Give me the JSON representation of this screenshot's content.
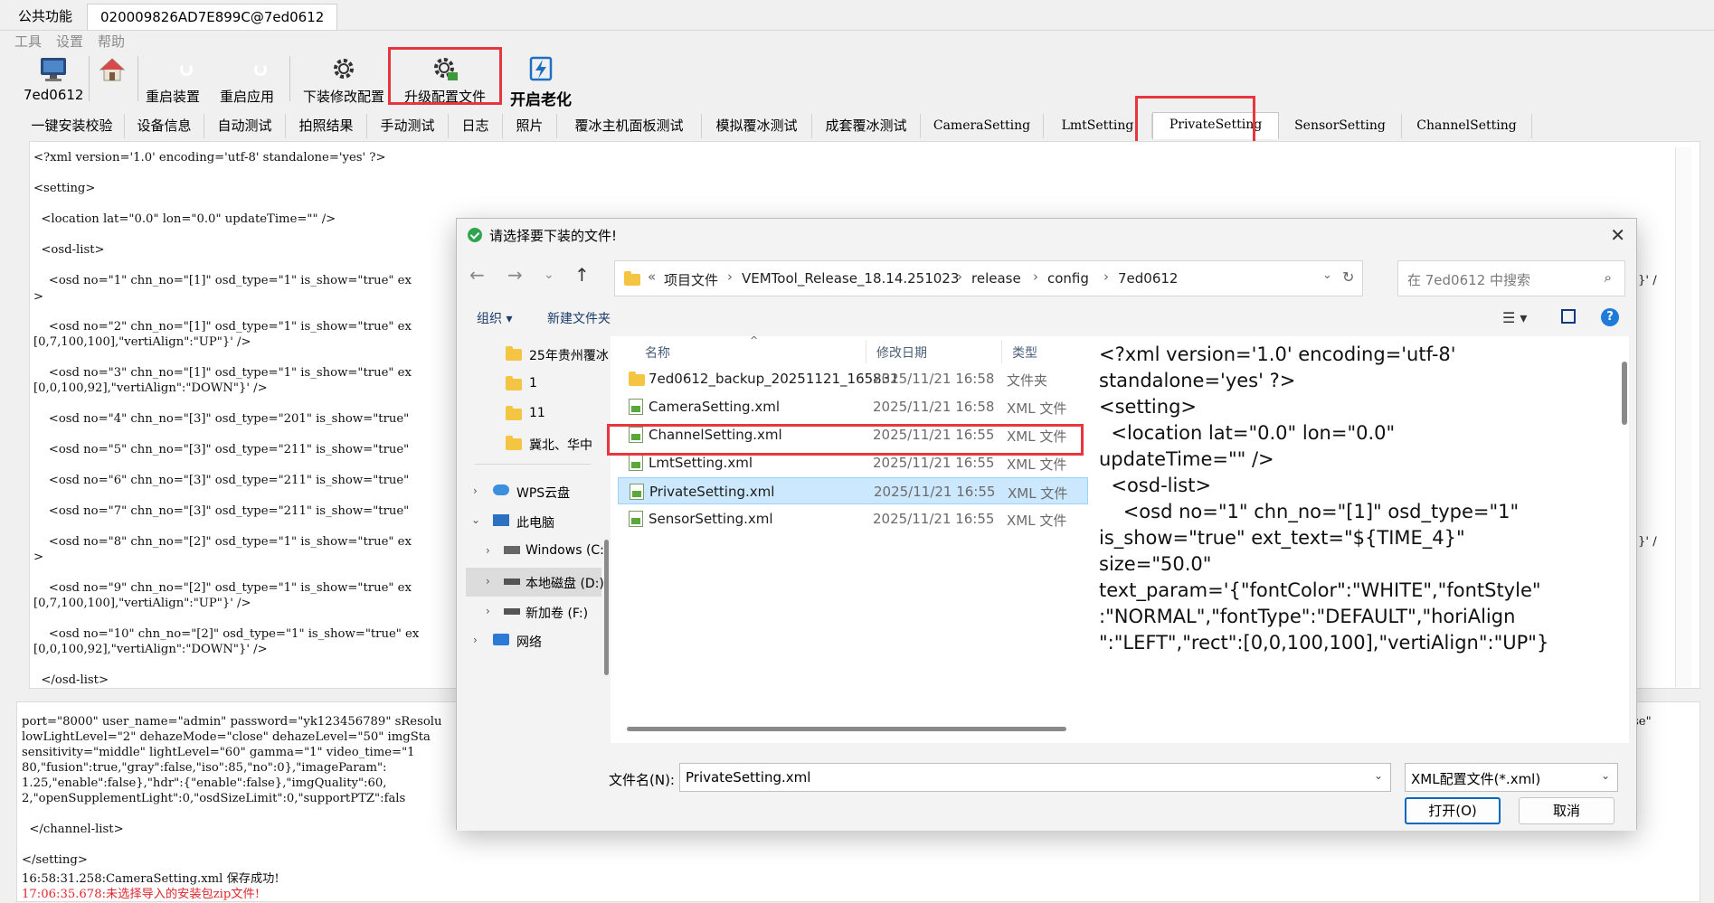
{
  "window_tabs": [
    "公共功能",
    "020009826AD7E899C@7ed0612"
  ],
  "menu": [
    "工具",
    "设置",
    "帮助"
  ],
  "toolbar": {
    "device_label": "7ed0612",
    "restart_device": "重启装置",
    "restart_app": "重启应用",
    "download_config": "下装修改配置",
    "upgrade_config": "升级配置文件",
    "start_aging": "开启老化"
  },
  "content_tabs": [
    "一键安装校验",
    "设备信息",
    "自动测试",
    "拍照结果",
    "手动测试",
    "日志",
    "照片",
    "覆冰主机面板测试",
    "模拟覆冰测试",
    "成套覆冰测试",
    "CameraSetting",
    "LmtSetting",
    "PrivateSetting",
    "SensorSetting",
    "ChannelSetting"
  ],
  "active_tab": "PrivateSetting",
  "xml_lines": [
    "<?xml version='1.0' encoding='utf-8' standalone='yes' ?>",
    "<setting>",
    "  <location lat=\"0.0\" lon=\"0.0\" updateTime=\"\" />",
    "  <osd-list>",
    "    <osd no=\"1\" chn_no=\"[1]\" osd_type=\"1\" is_show=\"true\" ex",
    ">",
    "    <osd no=\"2\" chn_no=\"[1]\" osd_type=\"1\" is_show=\"true\" ex",
    "[0,7,100,100],\"vertiAlign\":\"UP\"}' />",
    "    <osd no=\"3\" chn_no=\"[1]\" osd_type=\"1\" is_show=\"true\" ex",
    "[0,0,100,92],\"vertiAlign\":\"DOWN\"}' />",
    "    <osd no=\"4\" chn_no=\"[3]\" osd_type=\"201\" is_show=\"true\"",
    "    <osd no=\"5\" chn_no=\"[3]\" osd_type=\"211\" is_show=\"true\"",
    "    <osd no=\"6\" chn_no=\"[3]\" osd_type=\"211\" is_show=\"true\"",
    "    <osd no=\"7\" chn_no=\"[3]\" osd_type=\"211\" is_show=\"true\"",
    "    <osd no=\"8\" chn_no=\"[2]\" osd_type=\"1\" is_show=\"true\" ex",
    ">",
    "    <osd no=\"9\" chn_no=\"[2]\" osd_type=\"1\" is_show=\"true\" ex",
    "[0,7,100,100],\"vertiAlign\":\"UP\"}' />",
    "    <osd no=\"10\" chn_no=\"[2]\" osd_type=\"1\" is_show=\"true\" ex",
    "[0,0,100,92],\"vertiAlign\":\"DOWN\"}' />",
    "  </osd-list>"
  ],
  "xml_right_fragments": [
    "}' /",
    "}' /"
  ],
  "log_lines": [
    "port=\"8000\" user_name=\"admin\" password=\"yk123456789\" sResolu",
    "lowLightLevel=\"2\" dehazeMode=\"close\" dehazeLevel=\"50\" imgSta",
    "sensitivity=\"middle\" lightLevel=\"60\" gamma=\"1\" video_time=\"1",
    "80,\"fusion\":true,\"gray\":false,\"iso\":85,\"no\":0},\"imageParam\":",
    "1.25,\"enable\":false},\"hdr\":{\"enable\":false},\"imgQuality\":60,",
    "2,\"openSupplementLight\":0,\"osdSizeLimit\":0,\"supportPTZ\":fals",
    "  </channel-list>",
    "</setting>",
    "16:58:31.258:CameraSetting.xml 保存成功!",
    "17:06:35.678:未选择导入的安装包zip文件!"
  ],
  "log_right_fragment": "se\"",
  "dialog": {
    "title": "请选择要下装的文件!",
    "path": [
      "项目文件",
      "VEMTool_Release_18.14.251023",
      "release",
      "config",
      "7ed0612"
    ],
    "path_prefix": "«",
    "search_placeholder": "在 7ed0612 中搜索",
    "organize": "组织 ▾",
    "new_folder": "新建文件夹",
    "nav_items": [
      {
        "label": "25年贵州覆冰",
        "type": "folder"
      },
      {
        "label": "1",
        "type": "folder"
      },
      {
        "label": "11",
        "type": "folder"
      },
      {
        "label": "冀北、华中",
        "type": "folder"
      },
      {
        "label": "WPS云盘",
        "type": "cloud"
      },
      {
        "label": "此电脑",
        "type": "pc"
      },
      {
        "label": "Windows (C:)",
        "type": "drive"
      },
      {
        "label": "本地磁盘 (D:)",
        "type": "drive"
      },
      {
        "label": "新加卷 (F:)",
        "type": "drive"
      },
      {
        "label": "网络",
        "type": "network"
      }
    ],
    "columns": {
      "name": "名称",
      "date": "修改日期",
      "type": "类型"
    },
    "files": [
      {
        "name": "7ed0612_backup_20251121_165831",
        "date": "2025/11/21 16:58",
        "type": "文件夹",
        "icon": "folder"
      },
      {
        "name": "CameraSetting.xml",
        "date": "2025/11/21 16:58",
        "type": "XML 文件",
        "icon": "xml"
      },
      {
        "name": "ChannelSetting.xml",
        "date": "2025/11/21 16:55",
        "type": "XML 文件",
        "icon": "xml"
      },
      {
        "name": "LmtSetting.xml",
        "date": "2025/11/21 16:55",
        "type": "XML 文件",
        "icon": "xml"
      },
      {
        "name": "PrivateSetting.xml",
        "date": "2025/11/21 16:55",
        "type": "XML 文件",
        "icon": "xml"
      },
      {
        "name": "SensorSetting.xml",
        "date": "2025/11/21 16:55",
        "type": "XML 文件",
        "icon": "xml"
      }
    ],
    "selected_file": "PrivateSetting.xml",
    "preview_lines": [
      "<?xml version='1.0' encoding='utf-8'",
      "standalone='yes' ?>",
      "<setting>",
      "  <location lat=\"0.0\" lon=\"0.0\"",
      "updateTime=\"\" />",
      "  <osd-list>",
      "    <osd no=\"1\" chn_no=\"[1]\" osd_type=\"1\"",
      "is_show=\"true\" ext_text=\"${TIME_4}\"",
      "size=\"50.0\"",
      "text_param='{\"fontColor\":\"WHITE\",\"fontStyle\"",
      ":\"NORMAL\",\"fontType\":\"DEFAULT\",\"horiAlign",
      "\":\"LEFT\",\"rect\":[0,0,100,100],\"vertiAlign\":\"UP\"}"
    ],
    "filename_label": "文件名(N):",
    "filename_value": "PrivateSetting.xml",
    "filter_value": "XML配置文件(*.xml)",
    "open": "打开(O)",
    "cancel": "取消"
  },
  "colors": {
    "highlight_red": "#e8363f",
    "selection_blue": "#cce8ff",
    "log_error": "#e0262d"
  }
}
